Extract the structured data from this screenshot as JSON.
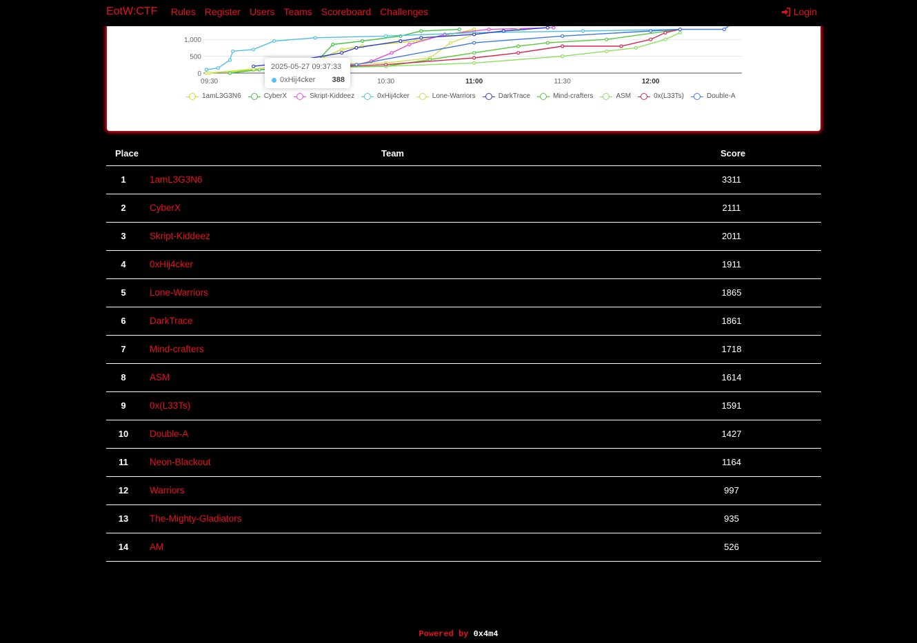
{
  "nav": {
    "brand": "EotW:CTF",
    "links": [
      "Rules",
      "Register",
      "Users",
      "Teams",
      "Scoreboard",
      "Challenges"
    ],
    "login": "Login"
  },
  "chart_data": {
    "type": "line",
    "y_ticks": [
      "0",
      "500",
      "1,000"
    ],
    "x_ticks": [
      "09:30",
      "10:00",
      "10:30",
      "11:00",
      "11:30",
      "12:00"
    ],
    "tooltip": {
      "time": "2025-05-27 09:37:33",
      "team": "0xHij4cker",
      "value": "388"
    },
    "series": [
      {
        "name": "1amL3G3N6",
        "color": "#c8d92a",
        "points": [
          [
            "09:29",
            0
          ],
          [
            "09:45",
            90
          ],
          [
            "09:58",
            150
          ],
          [
            "10:07",
            400
          ],
          [
            "10:15",
            700
          ],
          [
            "10:22",
            800
          ],
          [
            "10:40",
            950
          ],
          [
            "10:52",
            1150
          ],
          [
            "11:00",
            1300
          ]
        ]
      },
      {
        "name": "CyberX",
        "color": "#3fc23f",
        "points": [
          [
            "09:37",
            0
          ],
          [
            "09:47",
            100
          ],
          [
            "10:05",
            200
          ],
          [
            "10:12",
            850
          ],
          [
            "10:22",
            950
          ],
          [
            "10:35",
            1100
          ],
          [
            "10:42",
            1250
          ],
          [
            "10:55",
            1300
          ]
        ]
      },
      {
        "name": "Skript-Kiddeez",
        "color": "#e548d7",
        "points": [
          [
            "09:50",
            150
          ],
          [
            "10:20",
            250
          ],
          [
            "10:25",
            350
          ],
          [
            "10:32",
            600
          ],
          [
            "10:38",
            850
          ],
          [
            "10:50",
            1150
          ],
          [
            "11:05",
            1300
          ],
          [
            "11:27",
            1350
          ]
        ]
      },
      {
        "name": "0xHij4cker",
        "color": "#4cc0e6",
        "points": [
          [
            "09:29",
            100
          ],
          [
            "09:33",
            150
          ],
          [
            "09:37",
            388
          ],
          [
            "09:38",
            650
          ],
          [
            "09:45",
            700
          ],
          [
            "09:52",
            950
          ],
          [
            "10:06",
            1050
          ],
          [
            "10:30",
            1100
          ],
          [
            "11:00",
            1200
          ],
          [
            "11:37",
            1250
          ],
          [
            "12:10",
            1300
          ]
        ]
      },
      {
        "name": "Lone-Warriors",
        "color": "#cfe04a",
        "points": [
          [
            "09:30",
            0
          ],
          [
            "09:45",
            120
          ],
          [
            "10:00",
            250
          ],
          [
            "10:30",
            300
          ],
          [
            "10:45",
            450
          ],
          [
            "10:52",
            900
          ],
          [
            "11:00",
            1150
          ],
          [
            "11:15",
            1300
          ]
        ]
      },
      {
        "name": "DarkTrace",
        "color": "#2e3fdb",
        "points": [
          [
            "09:45",
            200
          ],
          [
            "09:55",
            300
          ],
          [
            "10:15",
            600
          ],
          [
            "10:20",
            750
          ],
          [
            "10:35",
            950
          ],
          [
            "10:42",
            1050
          ],
          [
            "11:00",
            1150
          ],
          [
            "11:10",
            1250
          ],
          [
            "11:25",
            1350
          ]
        ]
      },
      {
        "name": "Mind-crafters",
        "color": "#55c93a",
        "points": [
          [
            "10:00",
            150
          ],
          [
            "10:30",
            200
          ],
          [
            "10:45",
            400
          ],
          [
            "11:00",
            600
          ],
          [
            "11:15",
            800
          ],
          [
            "11:25",
            900
          ],
          [
            "11:45",
            1000
          ],
          [
            "12:10",
            1300
          ]
        ]
      },
      {
        "name": "ASM",
        "color": "#8ce05a",
        "points": [
          [
            "10:30",
            200
          ],
          [
            "11:00",
            300
          ],
          [
            "11:30",
            500
          ],
          [
            "11:45",
            650
          ],
          [
            "11:55",
            750
          ],
          [
            "12:05",
            1000
          ],
          [
            "12:10",
            1200
          ]
        ]
      },
      {
        "name": "0x(L33Ts)",
        "color": "#d8244d",
        "points": [
          [
            "09:50",
            150
          ],
          [
            "10:00",
            150
          ],
          [
            "10:30",
            250
          ],
          [
            "11:00",
            450
          ],
          [
            "11:15",
            600
          ],
          [
            "11:30",
            800
          ],
          [
            "11:50",
            800
          ],
          [
            "12:00",
            1000
          ],
          [
            "12:05",
            1200
          ],
          [
            "12:10",
            1300
          ]
        ]
      },
      {
        "name": "Double-A",
        "color": "#3d78e0",
        "points": [
          [
            "09:50",
            200
          ],
          [
            "10:20",
            250
          ],
          [
            "11:00",
            900
          ],
          [
            "11:30",
            1100
          ],
          [
            "12:00",
            1250
          ],
          [
            "12:10",
            1300
          ],
          [
            "12:25",
            1300
          ],
          [
            "12:28",
            1500
          ]
        ]
      }
    ]
  },
  "table": {
    "headers": {
      "place": "Place",
      "team": "Team",
      "score": "Score"
    },
    "rows": [
      {
        "place": "1",
        "team": "1amL3G3N6",
        "score": "3311"
      },
      {
        "place": "2",
        "team": "CyberX",
        "score": "2111"
      },
      {
        "place": "3",
        "team": "Skript-Kiddeez",
        "score": "2011"
      },
      {
        "place": "4",
        "team": "0xHij4cker",
        "score": "1911"
      },
      {
        "place": "5",
        "team": "Lone-Warriors",
        "score": "1865"
      },
      {
        "place": "6",
        "team": "DarkTrace",
        "score": "1861"
      },
      {
        "place": "7",
        "team": "Mind-crafters",
        "score": "1718"
      },
      {
        "place": "8",
        "team": "ASM",
        "score": "1614"
      },
      {
        "place": "9",
        "team": "0x(L33Ts)",
        "score": "1591"
      },
      {
        "place": "10",
        "team": "Double-A",
        "score": "1427"
      },
      {
        "place": "11",
        "team": "Neon-Blackout",
        "score": "1164"
      },
      {
        "place": "12",
        "team": "Warriors",
        "score": "997"
      },
      {
        "place": "13",
        "team": "The-Mighty-Gladiators",
        "score": "935"
      },
      {
        "place": "14",
        "team": "AM",
        "score": "526"
      }
    ]
  },
  "footer": {
    "prefix": "Powered by",
    "author": "0x4m4"
  }
}
